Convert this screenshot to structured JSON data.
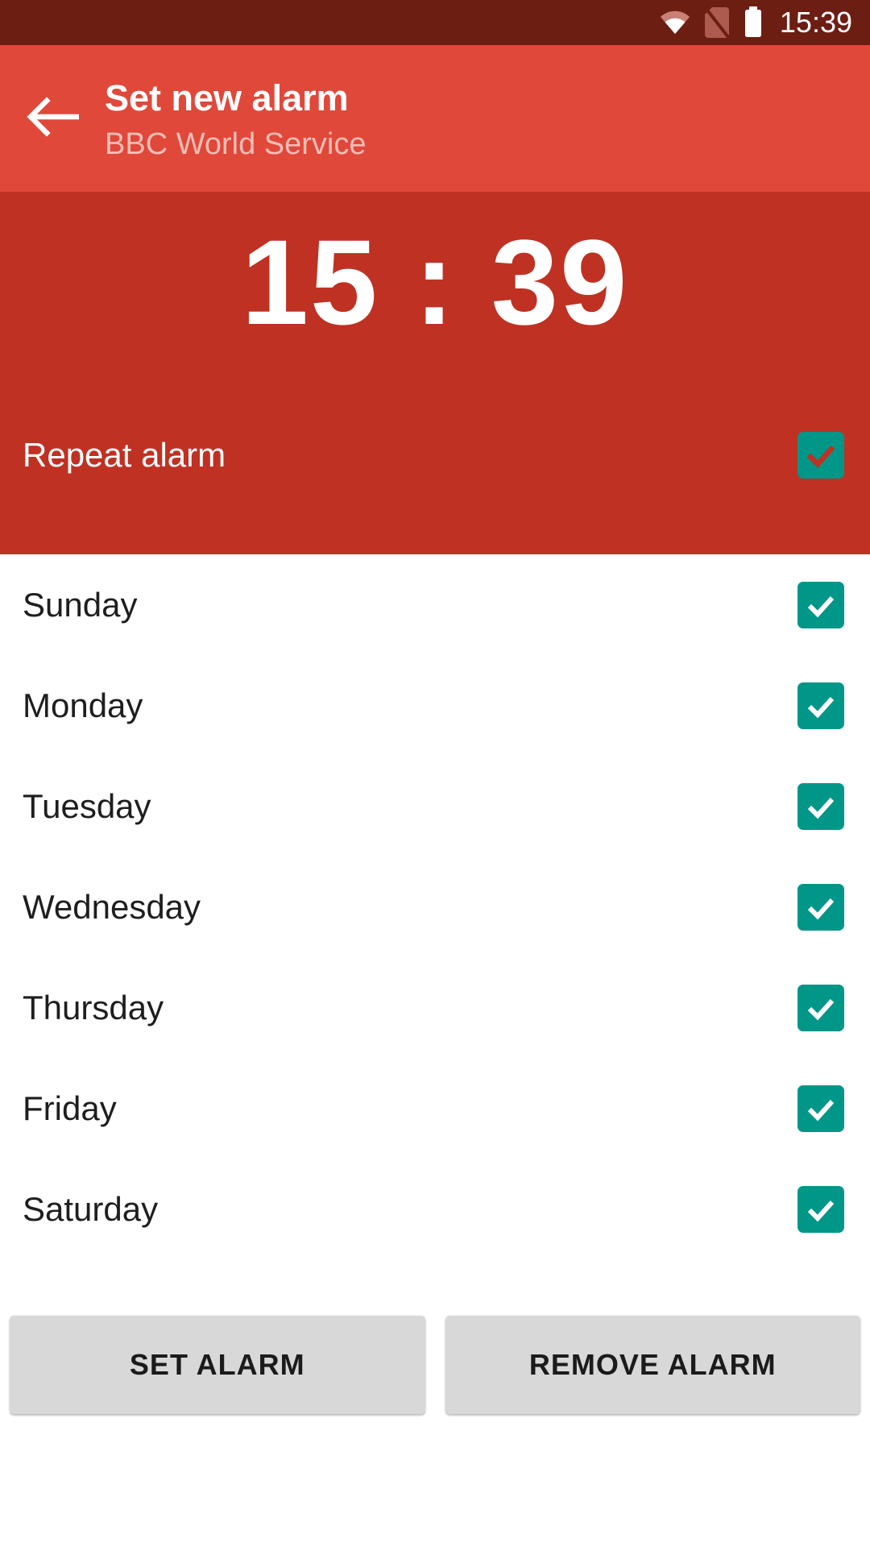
{
  "status_bar": {
    "time": "15:39",
    "icons": [
      {
        "name": "wifi-icon",
        "label": "wifi"
      },
      {
        "name": "no-sim-card-icon",
        "label": "no SIM card"
      },
      {
        "name": "battery-icon",
        "label": "battery"
      }
    ],
    "background_color": "#6D1E13"
  },
  "app_bar": {
    "back_icon": "back-arrow-icon",
    "title": "Set new alarm",
    "subtitle": "BBC World Service",
    "background_color": "#E0483A"
  },
  "clock_panel": {
    "alarm_time": "15 : 39",
    "background_color": "#BF3122",
    "repeat": {
      "label": "Repeat alarm",
      "checked": true,
      "checkbox_color": "#009688",
      "check_color": "#BF3122"
    }
  },
  "days": [
    {
      "label": "Sunday",
      "checked": true
    },
    {
      "label": "Monday",
      "checked": true
    },
    {
      "label": "Tuesday",
      "checked": true
    },
    {
      "label": "Wednesday",
      "checked": true
    },
    {
      "label": "Thursday",
      "checked": true
    },
    {
      "label": "Friday",
      "checked": true
    },
    {
      "label": "Saturday",
      "checked": true
    }
  ],
  "day_checkbox": {
    "checkbox_color": "#009688",
    "check_color": "#FFFFFF"
  },
  "buttons": {
    "set_alarm": "SET ALARM",
    "remove_alarm": "REMOVE ALARM",
    "background_color": "#D8D8D8"
  }
}
